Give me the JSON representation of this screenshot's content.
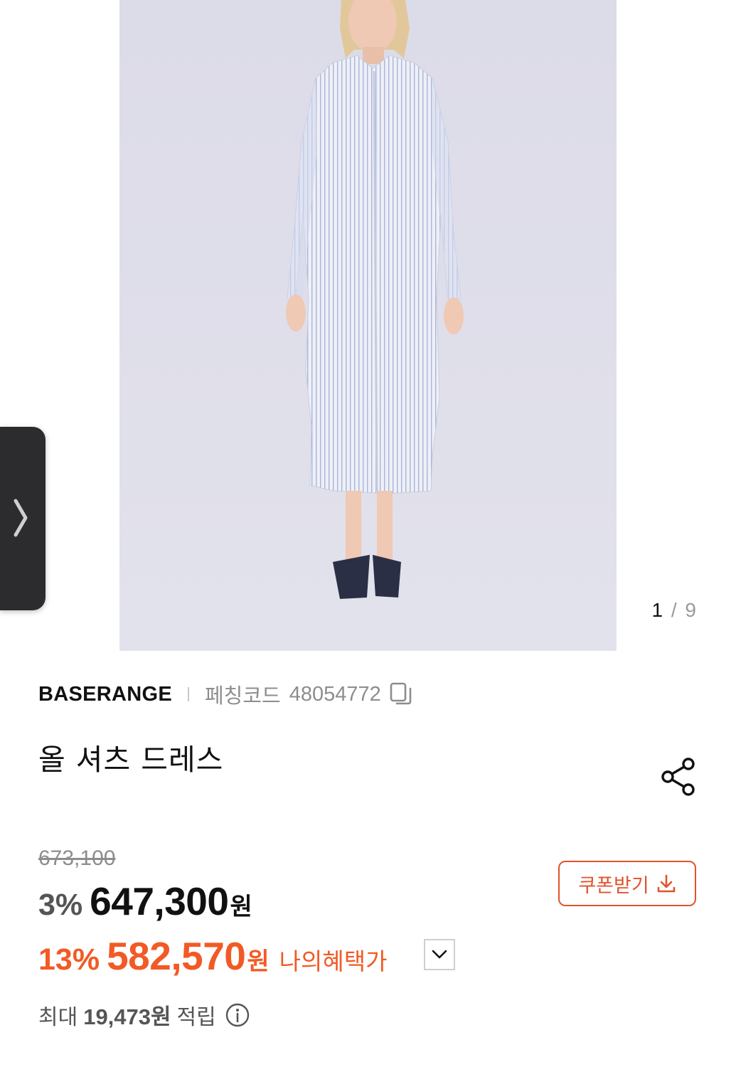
{
  "gallery": {
    "counter_current": "1",
    "counter_separator": " / ",
    "counter_total": "9"
  },
  "product": {
    "brand": "BASERANGE",
    "code_label": "페칭코드",
    "code_value": "48054772",
    "title": "올 셔츠 드레스"
  },
  "price": {
    "original": "673,100",
    "discount_rate": "3%",
    "sale_price": "647,300",
    "currency": "원"
  },
  "benefit": {
    "discount_rate": "13%",
    "price": "582,570",
    "currency": "원",
    "label": "나의혜택가"
  },
  "coupon": {
    "label": "쿠폰받기"
  },
  "points": {
    "prefix": "최대",
    "amount": "19,473원",
    "suffix": "적립"
  },
  "colors": {
    "accent": "#f25a25",
    "coupon_border": "#e0532d",
    "muted": "#8d8d8d"
  },
  "icons": {
    "copy": "copy-icon",
    "share": "share-icon",
    "download": "download-icon",
    "dropdown": "chevron-down-icon",
    "info": "info-icon",
    "side_tab": "chevron-right-icon"
  }
}
